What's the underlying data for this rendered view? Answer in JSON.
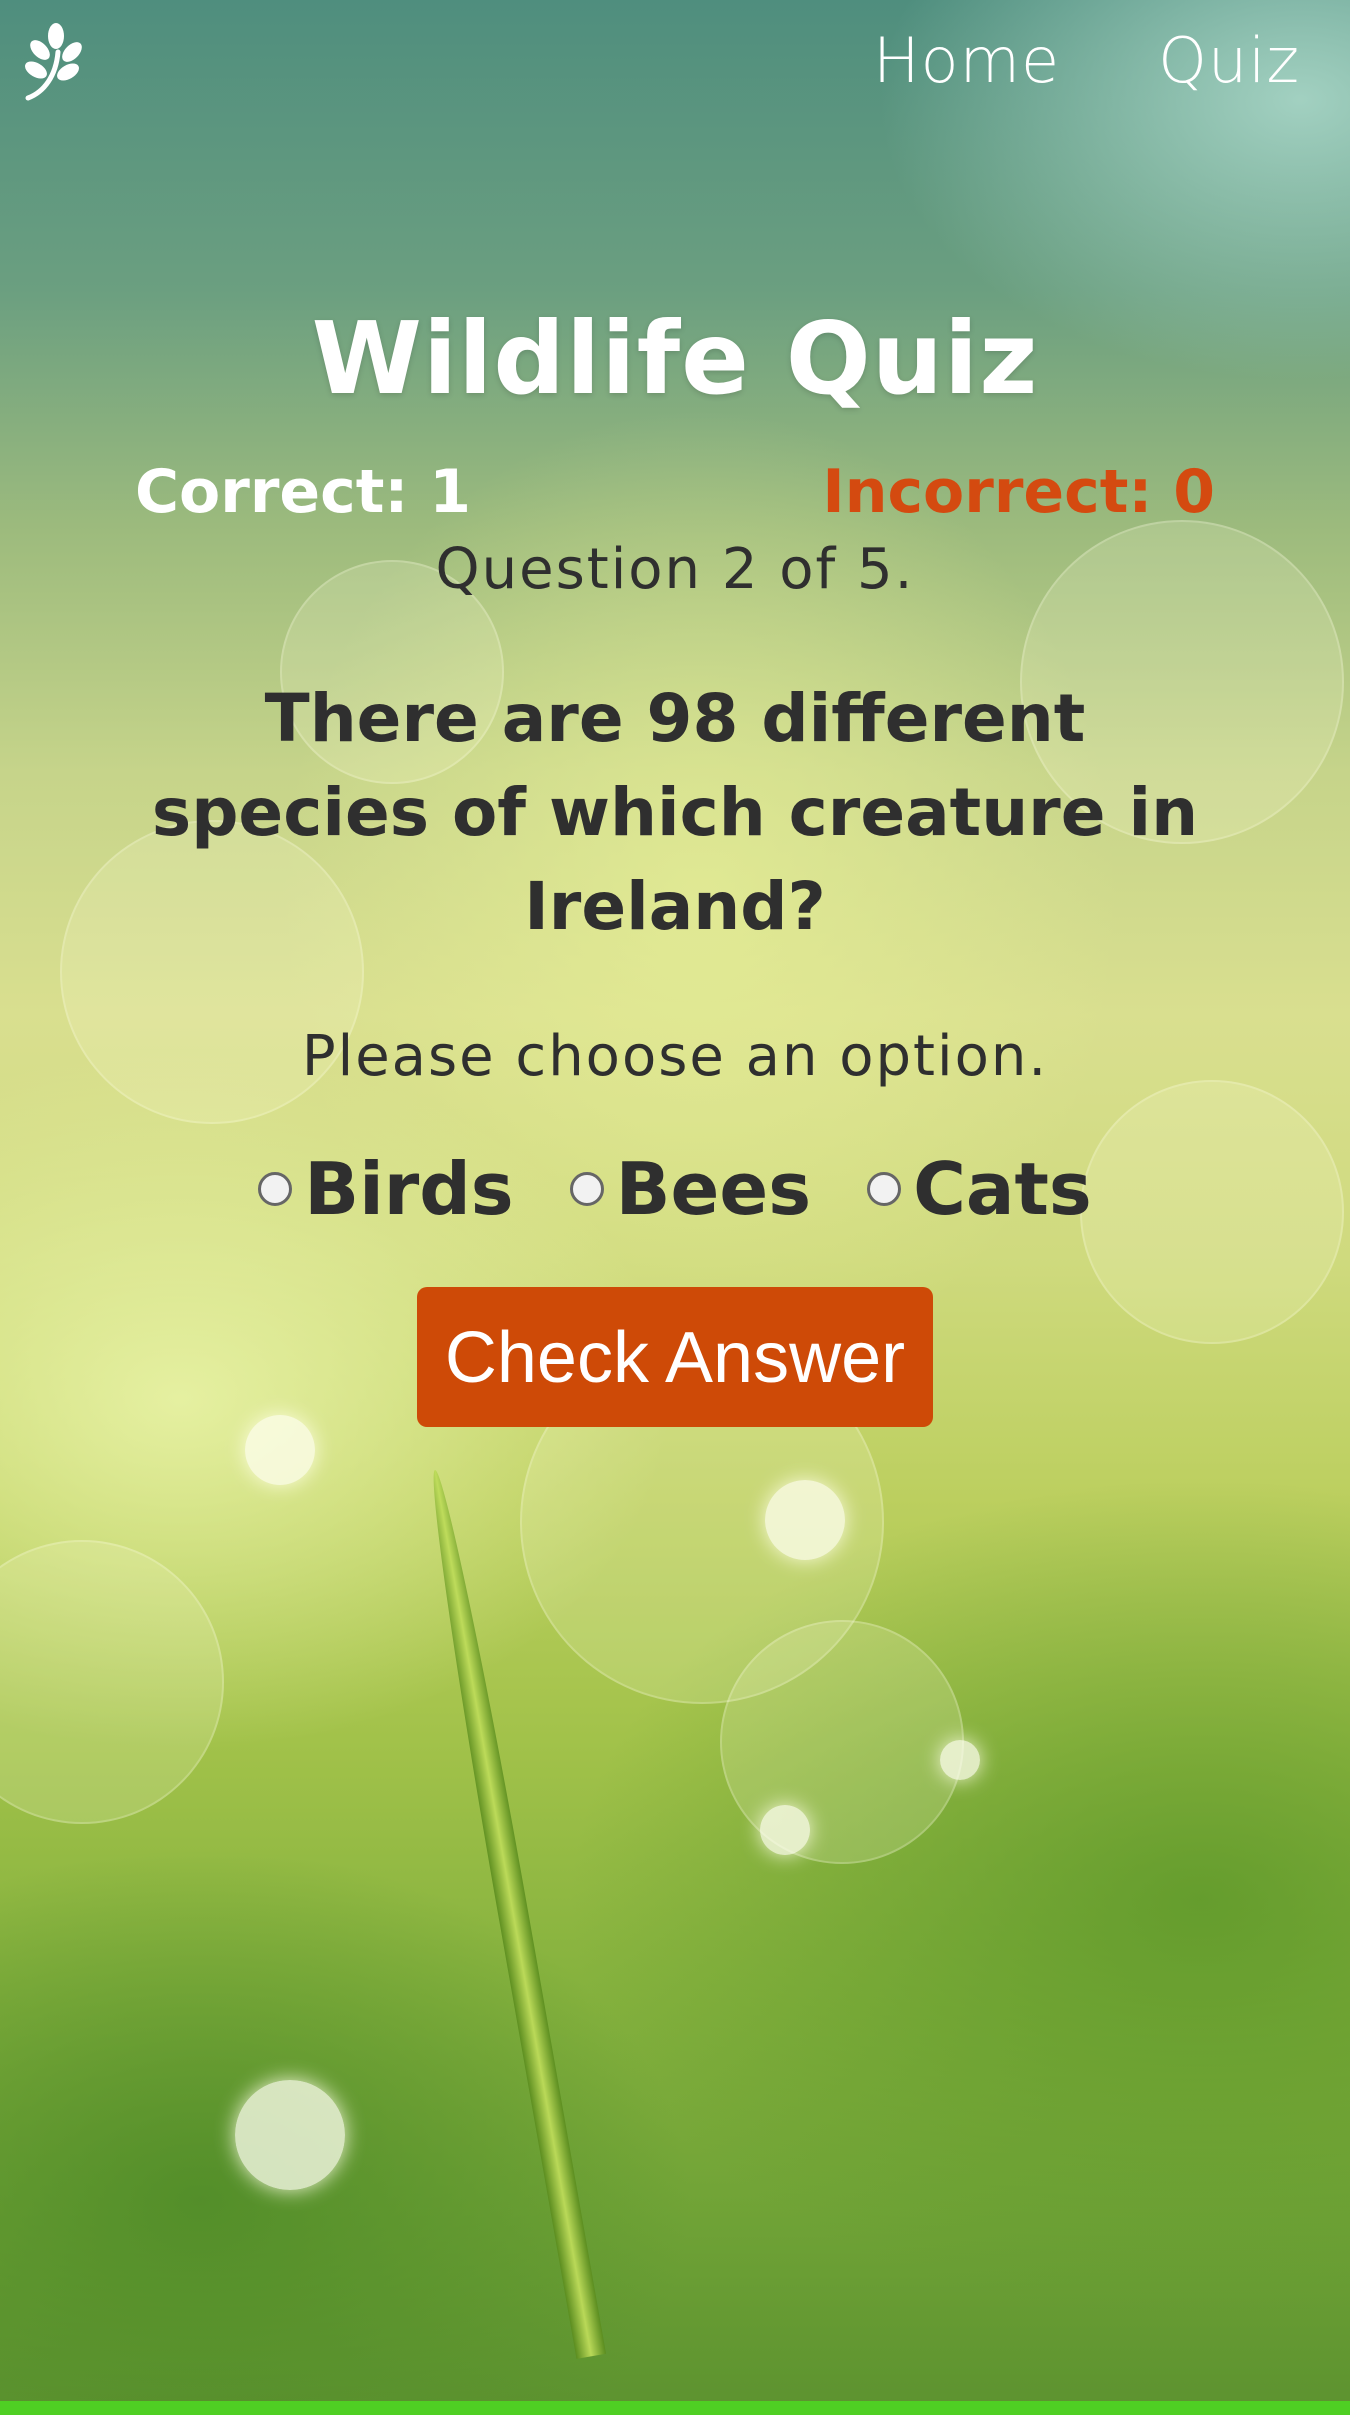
{
  "nav": {
    "logo_icon": "leaf-sprig-icon",
    "links": [
      {
        "label": "Home"
      },
      {
        "label": "Quiz"
      }
    ]
  },
  "quiz": {
    "title": "Wildlife Quiz",
    "correct_label": "Correct: 1",
    "incorrect_label": "Incorrect: 0",
    "progress": "Question 2 of 5.",
    "question": "There are 98 different species of which creature in Ireland?",
    "prompt": "Please choose an option.",
    "options": [
      {
        "label": "Birds"
      },
      {
        "label": "Bees"
      },
      {
        "label": "Cats"
      }
    ],
    "check_button": "Check Answer"
  },
  "colors": {
    "accent": "#ce4a07",
    "incorrect": "#d44a10",
    "footer_bar": "#4fcf23",
    "text_dark": "#2f2f2f",
    "text_light": "#ffffff"
  }
}
